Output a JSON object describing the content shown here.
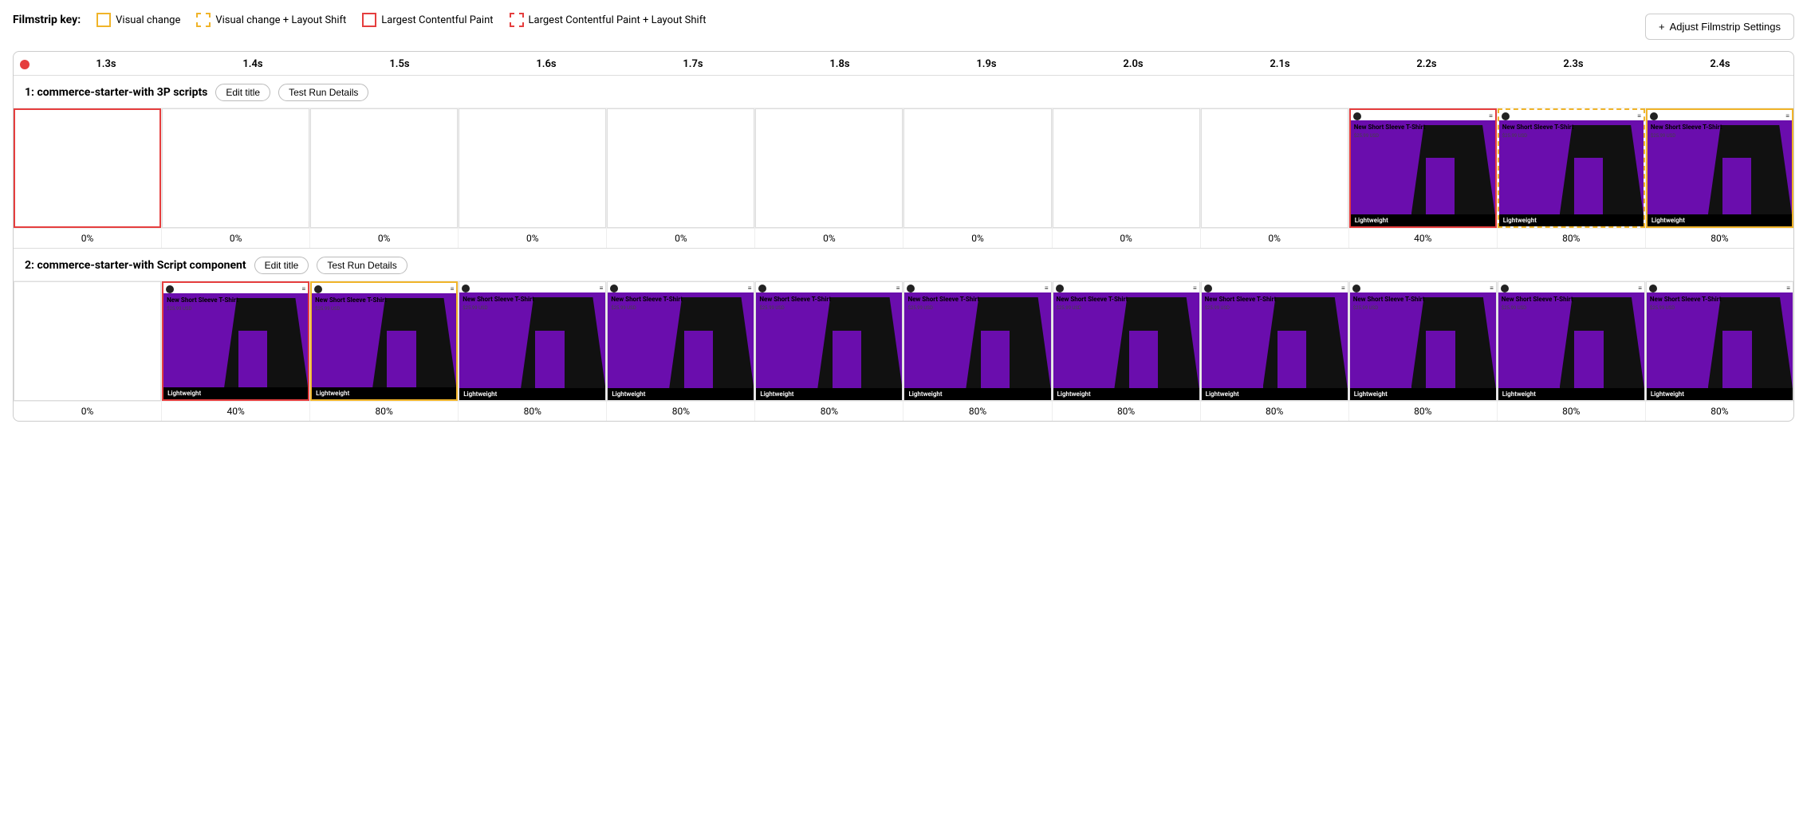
{
  "filmstripKey": {
    "label": "Filmstrip key:",
    "items": [
      {
        "id": "visual-change",
        "style": "solid-yellow",
        "text": "Visual change"
      },
      {
        "id": "visual-change-layout-shift",
        "style": "dashed-yellow",
        "text": "Visual change + Layout Shift"
      },
      {
        "id": "lcp",
        "style": "solid-red",
        "text": "Largest Contentful Paint"
      },
      {
        "id": "lcp-layout-shift",
        "style": "dashed-red",
        "text": "Largest Contentful Paint + Layout Shift"
      }
    ]
  },
  "adjustBtn": {
    "label": "Adjust Filmstrip Settings",
    "icon": "+"
  },
  "timeline": {
    "ticks": [
      "1.3s",
      "1.4s",
      "1.5s",
      "1.6s",
      "1.7s",
      "1.8s",
      "1.9s",
      "2.0s",
      "2.1s",
      "2.2s",
      "2.3s",
      "2.4s"
    ]
  },
  "rows": [
    {
      "id": "row1",
      "title": "1: commerce-starter-with 3P scripts",
      "editTitleLabel": "Edit title",
      "testRunLabel": "Test Run Details",
      "frames": [
        {
          "id": "r1f1",
          "type": "blank",
          "border": "red",
          "pct": "0%"
        },
        {
          "id": "r1f2",
          "type": "blank",
          "border": "none",
          "pct": "0%"
        },
        {
          "id": "r1f3",
          "type": "blank",
          "border": "none",
          "pct": "0%"
        },
        {
          "id": "r1f4",
          "type": "blank",
          "border": "none",
          "pct": "0%"
        },
        {
          "id": "r1f5",
          "type": "blank",
          "border": "none",
          "pct": "0%"
        },
        {
          "id": "r1f6",
          "type": "blank",
          "border": "none",
          "pct": "0%"
        },
        {
          "id": "r1f7",
          "type": "blank",
          "border": "none",
          "pct": "0%"
        },
        {
          "id": "r1f8",
          "type": "blank",
          "border": "none",
          "pct": "0%"
        },
        {
          "id": "r1f9",
          "type": "blank",
          "border": "none",
          "pct": "0%"
        },
        {
          "id": "r1f10",
          "type": "product",
          "border": "red",
          "pct": "40%",
          "title": "New Short Sleeve T-Shirt",
          "price": "$25.99 USD",
          "footer": "Lightweight"
        },
        {
          "id": "r1f11",
          "type": "product",
          "border": "dashed-yellow",
          "pct": "80%",
          "title": "New Short Sleeve T-Shirt",
          "price": "$25.99 USD",
          "footer": "Lightweight"
        },
        {
          "id": "r1f12",
          "type": "product",
          "border": "yellow",
          "pct": "80%",
          "title": "New Short Sleeve T-Shirt",
          "price": "$25.99 USD",
          "footer": "Lightweight"
        }
      ]
    },
    {
      "id": "row2",
      "title": "2: commerce-starter-with Script component",
      "editTitleLabel": "Edit title",
      "testRunLabel": "Test Run Details",
      "frames": [
        {
          "id": "r2f1",
          "type": "blank",
          "border": "none",
          "pct": "0%"
        },
        {
          "id": "r2f2",
          "type": "product",
          "border": "red",
          "pct": "40%",
          "title": "New Short Sleeve T-Shirt",
          "price": "$25.99 USD",
          "footer": "Lightweight"
        },
        {
          "id": "r2f3",
          "type": "product",
          "border": "yellow",
          "pct": "80%",
          "title": "New Short Sleeve T-Shirt",
          "price": "$25.99 USD",
          "footer": "Lightweight"
        },
        {
          "id": "r2f4",
          "type": "product",
          "border": "none",
          "pct": "80%",
          "title": "New Short Sleeve T-Shirt",
          "price": "$25.99 USD",
          "footer": "Lightweight"
        },
        {
          "id": "r2f5",
          "type": "product",
          "border": "none",
          "pct": "80%",
          "title": "New Short Sleeve T-Shirt",
          "price": "$25.99 USD",
          "footer": "Lightweight"
        },
        {
          "id": "r2f6",
          "type": "product",
          "border": "none",
          "pct": "80%",
          "title": "New Short Sleeve T-Shirt",
          "price": "$25.99 USD",
          "footer": "Lightweight"
        },
        {
          "id": "r2f7",
          "type": "product",
          "border": "none",
          "pct": "80%",
          "title": "New Short Sleeve T-Shirt",
          "price": "$25.99 USD",
          "footer": "Lightweight"
        },
        {
          "id": "r2f8",
          "type": "product",
          "border": "none",
          "pct": "80%",
          "title": "New Short Sleeve T-Shirt",
          "price": "$25.99 USD",
          "footer": "Lightweight"
        },
        {
          "id": "r2f9",
          "type": "product",
          "border": "none",
          "pct": "80%",
          "title": "New Short Sleeve T-Shirt",
          "price": "$25.99 USD",
          "footer": "Lightweight"
        },
        {
          "id": "r2f10",
          "type": "product",
          "border": "none",
          "pct": "80%",
          "title": "New Short Sleeve T-Shirt",
          "price": "$25.99 USD",
          "footer": "Lightweight"
        },
        {
          "id": "r2f11",
          "type": "product",
          "border": "none",
          "pct": "80%",
          "title": "New Short Sleeve T-Shirt",
          "price": "$25.99 USD",
          "footer": "Lightweight"
        },
        {
          "id": "r2f12",
          "type": "product",
          "border": "none",
          "pct": "80%",
          "title": "New Short Sleeve T-Shirt",
          "price": "$25.99 USD",
          "footer": "Lightweight"
        }
      ]
    }
  ]
}
